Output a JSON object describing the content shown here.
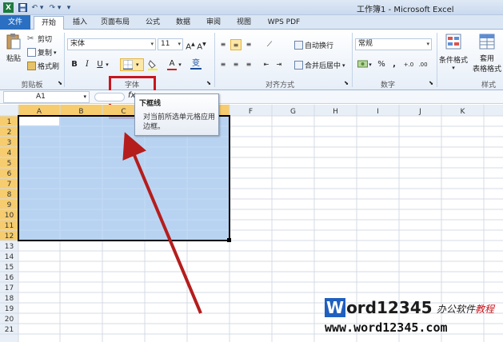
{
  "window": {
    "title": "工作簿1 - Microsoft Excel"
  },
  "tabs": [
    "文件",
    "开始",
    "插入",
    "页面布局",
    "公式",
    "数据",
    "审阅",
    "视图",
    "WPS PDF"
  ],
  "ribbon": {
    "clipboard": {
      "paste": "粘贴",
      "cut": "剪切",
      "copy": "复制",
      "format_painter": "格式刷",
      "label": "剪贴板"
    },
    "font": {
      "name": "宋体",
      "size": "11",
      "bold": "B",
      "italic": "I",
      "underline": "U",
      "wen": "变",
      "label": "字体"
    },
    "alignment": {
      "wrap": "自动换行",
      "merge": "合并后居中",
      "label": "对齐方式"
    },
    "number": {
      "format": "常规",
      "percent": "%",
      "comma": ",",
      "label": "数字"
    },
    "styles": {
      "conditional": "条件格式",
      "table": "套用",
      "table2": "表格格式",
      "label": "样式"
    }
  },
  "formula_bar": {
    "cell_ref": "A1",
    "fx": "fx"
  },
  "columns": [
    "A",
    "B",
    "C",
    "D",
    "E",
    "F",
    "G",
    "H",
    "I",
    "J",
    "K"
  ],
  "rows": [
    "1",
    "2",
    "3",
    "4",
    "5",
    "6",
    "7",
    "8",
    "9",
    "10",
    "11",
    "12",
    "13",
    "14",
    "15",
    "16",
    "17",
    "18",
    "19",
    "20",
    "21"
  ],
  "selection": {
    "range": "A1:E12"
  },
  "tooltip": {
    "title": "下框线",
    "desc": "对当前所选单元格应用边框。"
  },
  "watermark": {
    "brand_prefix": "W",
    "brand_rest": "ord12345",
    "slogan_a": "办公软件",
    "slogan_b": "教程",
    "url": "www.word12345.com"
  },
  "colors": {
    "accent": "#2a6fc1",
    "highlight": "#c8161d",
    "selection": "#aacbee"
  }
}
